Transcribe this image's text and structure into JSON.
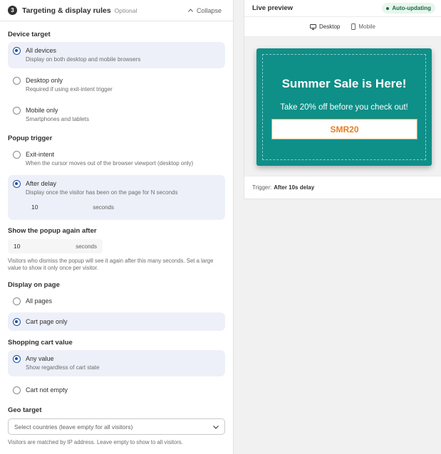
{
  "section": {
    "step": "3",
    "title": "Targeting & display rules",
    "optional": "Optional",
    "collapse": "Collapse"
  },
  "device": {
    "label": "Device target",
    "options": [
      {
        "label": "All devices",
        "desc": "Display on both desktop and mobile browsers",
        "selected": true
      },
      {
        "label": "Desktop only",
        "desc": "Required if using exit-intent trigger",
        "selected": false
      },
      {
        "label": "Mobile only",
        "desc": "Smartphones and tablets",
        "selected": false
      }
    ]
  },
  "trigger": {
    "label": "Popup trigger",
    "options": [
      {
        "label": "Exit-intent",
        "desc": "When the cursor moves out of the browser viewport (desktop only)",
        "selected": false
      },
      {
        "label": "After delay",
        "desc": "Display once the visitor has been on the page for N seconds",
        "selected": true
      }
    ],
    "delay_value": "10",
    "delay_unit": "seconds"
  },
  "show_again": {
    "label": "Show the popup again after",
    "value": "10",
    "unit": "seconds",
    "help": "Visitors who dismiss the popup will see it again after this many seconds. Set a large value to show it only once per visitor."
  },
  "page": {
    "label": "Display on page",
    "options": [
      {
        "label": "All pages",
        "selected": false
      },
      {
        "label": "Cart page only",
        "selected": true
      }
    ]
  },
  "cart": {
    "label": "Shopping cart value",
    "options": [
      {
        "label": "Any value",
        "desc": "Show regardless of cart state",
        "selected": true
      },
      {
        "label": "Cart not empty",
        "selected": false
      }
    ]
  },
  "geo": {
    "label": "Geo target",
    "placeholder": "Select countries (leave empty for all visitors)",
    "help": "Visitors are matched by IP address. Leave empty to show to all visitors."
  },
  "preview": {
    "title": "Live preview",
    "badge": "Auto-updating",
    "tabs": [
      {
        "label": "Desktop",
        "active": true
      },
      {
        "label": "Mobile",
        "active": false
      }
    ],
    "popup": {
      "title": "Summer Sale is Here!",
      "subtitle": "Take 20% off before you check out!",
      "code": "SMR20",
      "bg_color": "#0e8f88",
      "code_color": "#e67e22"
    },
    "trigger_label": "Trigger:",
    "trigger_value": "After 10s delay"
  }
}
